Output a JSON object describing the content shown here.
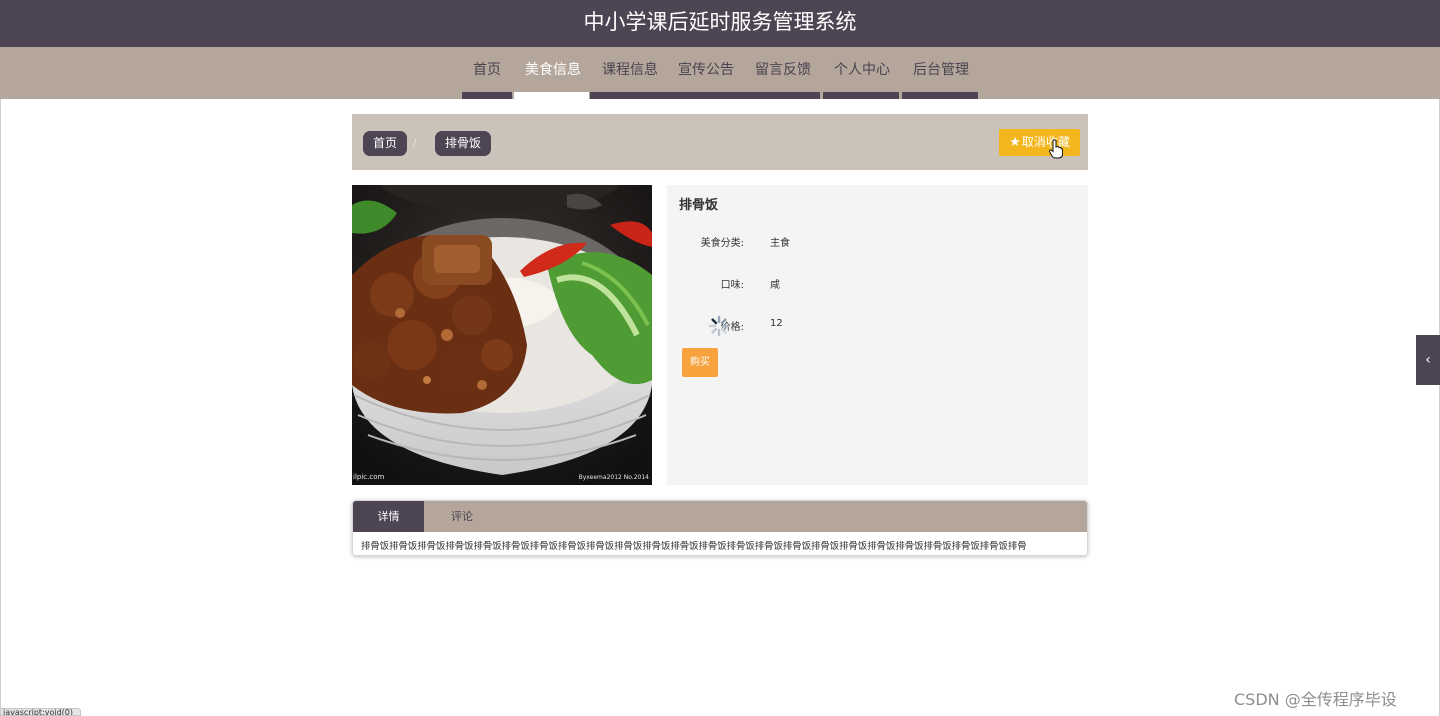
{
  "header": {
    "title": "中小学课后延时服务管理系统"
  },
  "nav": {
    "items": [
      {
        "label": "首页",
        "active": false
      },
      {
        "label": "美食信息",
        "active": true
      },
      {
        "label": "课程信息",
        "active": false
      },
      {
        "label": "宣传公告",
        "active": false
      },
      {
        "label": "留言反馈",
        "active": false
      },
      {
        "label": "个人中心",
        "active": false
      },
      {
        "label": "后台管理",
        "active": false
      }
    ]
  },
  "breadcrumb": {
    "home": "首页",
    "separator": "/",
    "current": "排骨饭"
  },
  "favorite": {
    "icon": "star-icon",
    "label": "取消收藏"
  },
  "photo": {
    "watermark_left": "ilpic.com",
    "watermark_right": "Byxeema2012 No.2014"
  },
  "detail": {
    "name": "排骨饭",
    "category_label": "美食分类:",
    "category_value": "主食",
    "taste_label": "口味:",
    "taste_value": "咸",
    "price_label": "价格:",
    "price_value": "12",
    "buy_label": "购买"
  },
  "tabs": {
    "items": [
      {
        "label": "详情"
      },
      {
        "label": "评论"
      }
    ],
    "detail_text": "排骨饭排骨饭排骨饭排骨饭排骨饭排骨饭排骨饭排骨饭排骨饭排骨饭排骨饭排骨饭排骨饭排骨饭排骨饭排骨饭排骨饭排骨饭排骨饭排骨饭排骨饭排骨饭排骨饭排骨"
  },
  "side_toggle": {
    "icon": "chevron-left-icon",
    "glyph": "‹"
  },
  "status_bar": {
    "text": "javascript:void(0)"
  },
  "watermark": {
    "text": "CSDN @全传程序毕设"
  },
  "colors": {
    "primary": "#4d4553",
    "nav_bg": "#b5a69b",
    "accent_yellow": "#f3b61c",
    "accent_orange": "#f7a23c"
  }
}
